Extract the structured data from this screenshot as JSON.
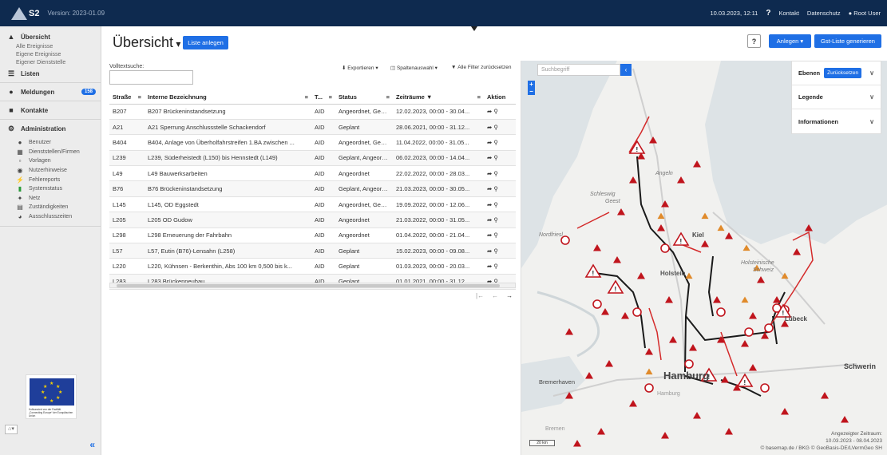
{
  "topbar": {
    "logo_text": "S2",
    "version": "Version: 2023-01.09",
    "datetime": "10.03.2023, 12:11",
    "help": "?",
    "links": [
      "Kontakt",
      "Datenschutz"
    ],
    "user": "Root User"
  },
  "sidebar": {
    "overview": "Übersicht",
    "overview_sub": [
      "Alle Ereignisse",
      "Eigene Ereignisse",
      "Eigener Dienststelle"
    ],
    "lists": "Listen",
    "messages": "Meldungen",
    "messages_badge": "158",
    "contacts": "Kontakte",
    "administration": "Administration",
    "admin_items": [
      "Benutzer",
      "Dienststellen/Firmen",
      "Vorlagen",
      "Nutzerhinweise",
      "Fehlereports",
      "Systemstatus",
      "Netz",
      "Zuständigkeiten",
      "Ausschlusszeiten"
    ],
    "eu_caption": "Kofinanziert von der Fazilität „Connecting Europe“ der Europäischen Union"
  },
  "header": {
    "title": "Übersicht",
    "create_list": "Liste anlegen",
    "help": "?",
    "create_dropdown": "Anlegen",
    "generate_list": "Gst-Liste generieren"
  },
  "table": {
    "search_label": "Volltextsuche:",
    "export": "Exportieren",
    "column_select": "Spaltenauswahl",
    "reset_filters": "Alle Filter zurücksetzen",
    "columns": [
      "Straße",
      "Interne Bezeichnung",
      "T...",
      "Status",
      "Zeiträume",
      "Aktion"
    ],
    "rows": [
      [
        "B207",
        "B207 Brückeninstandsetzung",
        "AID",
        "Angeordnet, Gepl...",
        "12.02.2023, 00:00 - 30.04..."
      ],
      [
        "A21",
        "A21 Sperrung Anschlussstelle Schackendorf",
        "AID",
        "Geplant",
        "28.06.2021, 00:00 - 31.12..."
      ],
      [
        "B404",
        "B404, Anlage von Überholfahrstreifen 1.BA zwischen ...",
        "AID",
        "Angeordnet, Gepl...",
        "11.04.2022, 00:00 - 31.05..."
      ],
      [
        "L239",
        "L239, Süderheistedt (L150) bis Hennstedt (L149)",
        "AID",
        "Geplant, Angeord...",
        "06.02.2023, 00:00 - 14.04..."
      ],
      [
        "L49",
        "L49 Bauwerksarbeiten",
        "AID",
        "Angeordnet",
        "22.02.2022, 00:00 - 28.03..."
      ],
      [
        "B76",
        "B76 Brückeninstandsetzung",
        "AID",
        "Geplant, Angeord...",
        "21.03.2023, 00:00 - 30.05..."
      ],
      [
        "L145",
        "L145, OD Eggstedt",
        "AID",
        "Angeordnet, Gepl...",
        "19.09.2022, 00:00 - 12.06..."
      ],
      [
        "L205",
        "L205 OD Gudow",
        "AID",
        "Angeordnet",
        "21.03.2022, 00:00 - 31.05..."
      ],
      [
        "L298",
        "L298 Erneuerung der Fahrbahn",
        "AID",
        "Angeordnet",
        "01.04.2022, 00:00 - 21.04..."
      ],
      [
        "L57",
        "L57, Eutin (B76)-Lensahn (L258)",
        "AID",
        "Geplant",
        "15.02.2023, 00:00 - 09.08..."
      ],
      [
        "L220",
        "L220, Kühnsen - Berkenthin, Abs 100 km 0,500 bis k...",
        "AID",
        "Geplant",
        "01.03.2023, 00:00 - 20.03..."
      ],
      [
        "L283",
        "L283 Brückenneubau",
        "AID",
        "Geplant",
        "01.01.2021, 00:00 - 31.12..."
      ]
    ]
  },
  "map": {
    "search_placeholder": "Suchbegriff",
    "zoom_in": "+",
    "zoom_out": "−",
    "panels": {
      "layers": "Ebenen",
      "reset": "Zurücksetzen",
      "legend": "Legende",
      "info": "Informationen"
    },
    "labels": {
      "hamburg": "Hamburg",
      "schwerin": "Schwerin",
      "bremerhaven": "Bremerhaven",
      "kiel": "Kiel",
      "luebeck": "Lübeck",
      "holstein": "Holstein",
      "schleswig": "Schleswig",
      "geest": "Geest",
      "angeln": "Angeln",
      "nordfriesland": "Nordfriesl",
      "holsteinische": "Holsteinische",
      "schweiz": "Schweiz",
      "hamburg_small": "Hamburg",
      "bremen": "Bremen"
    },
    "period_label": "Angezeigter Zeitraum:",
    "period_value": "10.03.2023 - 08.04.2023",
    "attribution": "© basemap.de / BKG © GeoBasis-DE/LVermGeo SH",
    "scale": "20 km",
    "colors": {
      "marker_red": "#c0141c",
      "marker_orange": "#e08a2a",
      "road_black": "#1a1a1a",
      "road_red": "#d42a2a"
    }
  }
}
